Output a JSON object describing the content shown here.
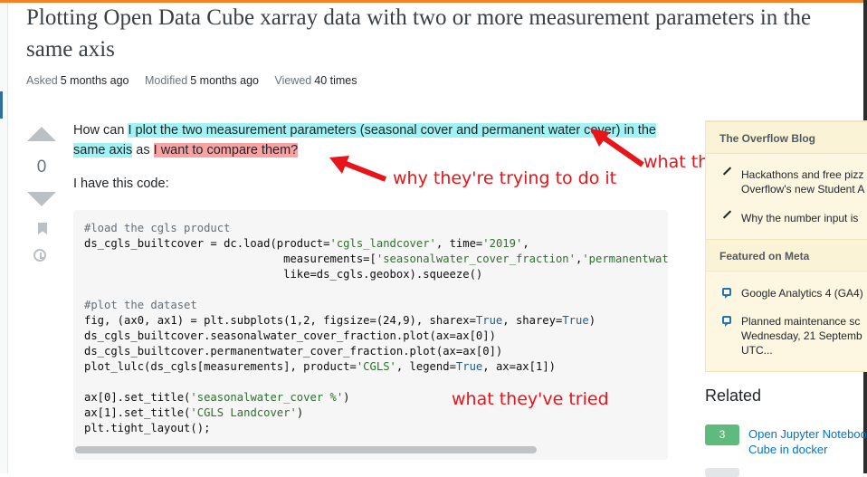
{
  "page": {
    "title": "Plotting Open Data Cube xarray data with two or more measurement parameters in the same axis",
    "meta": {
      "asked_label": "Asked",
      "asked_value": "5 months ago",
      "modified_label": "Modified",
      "modified_value": "5 months ago",
      "viewed_label": "Viewed",
      "viewed_value": "40 times"
    }
  },
  "question": {
    "score": "0",
    "text_1": "How can ",
    "text_hl1": "I plot the two measurement parameters (seasonal cover and permanent water cover) in the same axis",
    "text_2": " as ",
    "text_hl2": "I want to compare them?",
    "have_code": "I have this code:",
    "code_lines": [
      "#load the cgls product",
      "ds_cgls_builtcover = dc.load(product='cgls_landcover', time='2019',",
      "                              measurements=['seasonalwater_cover_fraction','permanentwater_cover_fraction'],",
      "                              like=ds_cgls.geobox).squeeze()",
      "",
      "#plot the dataset",
      "fig, (ax0, ax1) = plt.subplots(1,2, figsize=(24,9), sharex=True, sharey=True)",
      "ds_cgls_builtcover.seasonalwater_cover_fraction.plot(ax=ax[0])",
      "ds_cgls_builtcover.permanentwater_cover_fraction.plot(ax=ax[0])",
      "plot_lulc(ds_cgls[measurements], product='CGLS', legend=True, ax=ax[1])",
      "",
      "ax[0].set_title('seasonalwater_cover %')",
      "ax[1].set_title('CGLS Landcover')",
      "plt.tight_layout();"
    ]
  },
  "annotations": {
    "what": "what they're trying to do",
    "why": "why they're trying to do it",
    "tried": "what they've tried"
  },
  "sidebar": {
    "blog_header": "The Overflow Blog",
    "blog_items": [
      "Hackathons and free pizz",
      "Overflow's new Student A",
      "Why the number input is"
    ],
    "meta_header": "Featured on Meta",
    "meta_items": [
      "Google Analytics 4 (GA4)",
      "Planned maintenance sc",
      "Wednesday, 21 Septemb",
      "UTC..."
    ],
    "related_header": "Related",
    "related_items": [
      {
        "votes": "3",
        "title_line1": "Open Jupyter Noteboo",
        "title_line2": "Cube in docker"
      }
    ]
  },
  "colors": {
    "highlight_cyan": "#a0f2f5",
    "highlight_red": "#f7a3a3",
    "annotation": "#e8141a",
    "accent": "#f48225"
  }
}
